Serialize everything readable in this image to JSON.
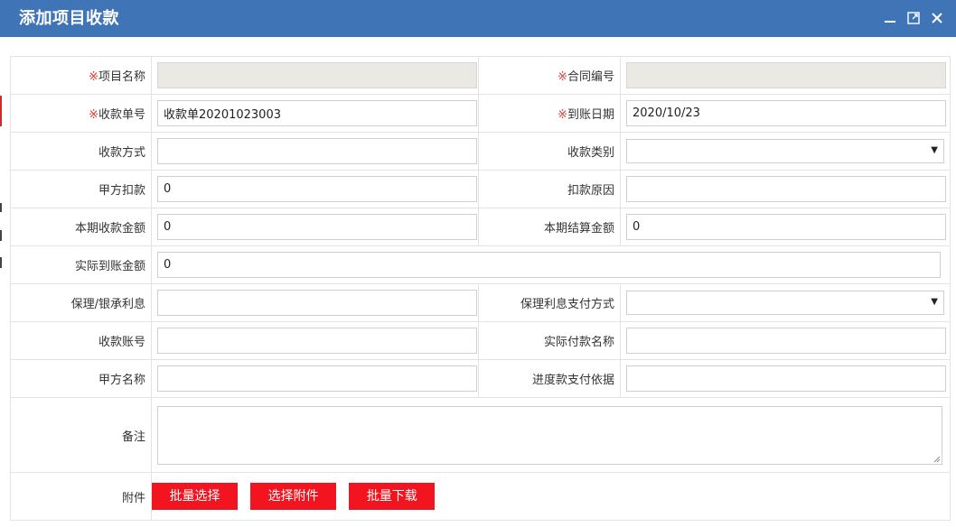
{
  "window": {
    "title": "添加项目收款",
    "controls": [
      "minimize-icon",
      "maximize-icon",
      "close-icon"
    ],
    "header_color": "#3f74b7"
  },
  "required_mark": "※",
  "rows": {
    "r1": {
      "left_label": "项目名称",
      "left_value": "",
      "right_label": "合同编号",
      "right_value": ""
    },
    "r2": {
      "left_label": "收款单号",
      "left_value": "收款单20201023003",
      "right_label": "到账日期",
      "right_value": "2020/10/23"
    },
    "r3": {
      "left_label": "收款方式",
      "left_value": "",
      "right_label": "收款类别",
      "right_value": ""
    },
    "r4": {
      "left_label": "甲方扣款",
      "left_value": "0",
      "right_label": "扣款原因",
      "right_value": ""
    },
    "r5": {
      "left_label": "本期收款金额",
      "left_value": "0",
      "right_label": "本期结算金额",
      "right_value": "0"
    },
    "r6": {
      "left_label": "实际到账金额",
      "left_value": "0"
    },
    "r7": {
      "left_label": "保理/银承利息",
      "left_value": "",
      "right_label": "保理利息支付方式",
      "right_value": ""
    },
    "r8": {
      "left_label": "收款账号",
      "left_value": "",
      "right_label": "实际付款名称",
      "right_value": ""
    },
    "r9": {
      "left_label": "甲方名称",
      "left_value": "",
      "right_label": "进度款支付依据",
      "right_value": ""
    },
    "r10": {
      "left_label": "备注",
      "left_value": ""
    },
    "r11": {
      "left_label": "附件"
    }
  },
  "attachment_buttons": {
    "batch_select": "批量选择",
    "select_attachment": "选择附件",
    "batch_download": "批量下载",
    "color": "#f2141e"
  }
}
